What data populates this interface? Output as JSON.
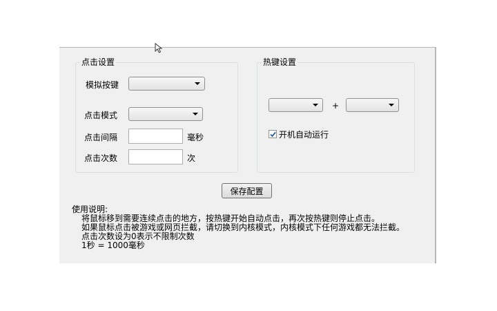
{
  "click_settings": {
    "title": "点击设置",
    "simulate_key_label": "模拟按键",
    "simulate_key_value": "",
    "click_mode_label": "点击模式",
    "click_mode_value": "",
    "interval_label": "点击间隔",
    "interval_value": "",
    "interval_unit": "毫秒",
    "count_label": "点击次数",
    "count_value": "",
    "count_unit": "次"
  },
  "hotkey_settings": {
    "title": "热键设置",
    "modifier_value": "",
    "plus": "+",
    "key_value": "",
    "autostart_label": "开机自动运行",
    "autostart_checked": true
  },
  "save_button": "保存配置",
  "usage": {
    "title": "使用说明:",
    "lines": [
      "将鼠标移到需要连续点击的地方，按热键开始自动点击，再次按热键则停止点击。",
      "如果鼠标点击被游戏或网页拦截，请切换到内核模式，内核模式下任何游戏都无法拦截。",
      "点击次数设为0表示不限制次数",
      "1秒 = 1000毫秒"
    ]
  },
  "colors": {
    "panel_bg": "#f0f0f0",
    "group_border": "#d5dfe5",
    "check_mark": "#2d5f9c"
  }
}
